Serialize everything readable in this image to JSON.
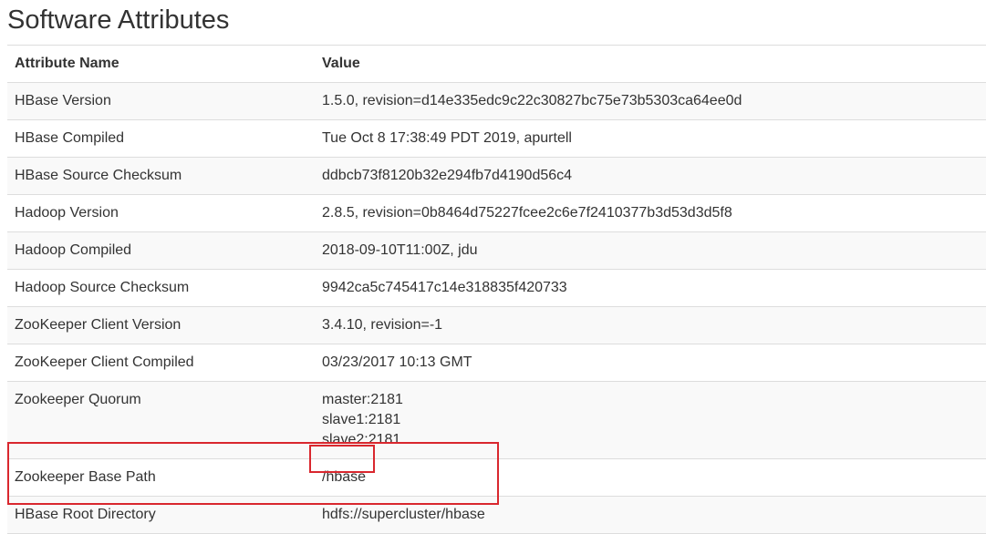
{
  "page": {
    "title": "Software Attributes"
  },
  "table": {
    "headers": {
      "name": "Attribute Name",
      "value": "Value"
    },
    "rows": [
      {
        "name": "HBase Version",
        "value": [
          "1.5.0, revision=d14e335edc9c22c30827bc75e73b5303ca64ee0d"
        ]
      },
      {
        "name": "HBase Compiled",
        "value": [
          "Tue Oct 8 17:38:49 PDT 2019, apurtell"
        ]
      },
      {
        "name": "HBase Source Checksum",
        "value": [
          "ddbcb73f8120b32e294fb7d4190d56c4"
        ]
      },
      {
        "name": "Hadoop Version",
        "value": [
          "2.8.5, revision=0b8464d75227fcee2c6e7f2410377b3d53d3d5f8"
        ]
      },
      {
        "name": "Hadoop Compiled",
        "value": [
          "2018-09-10T11:00Z, jdu"
        ]
      },
      {
        "name": "Hadoop Source Checksum",
        "value": [
          "9942ca5c745417c14e318835f420733"
        ]
      },
      {
        "name": "ZooKeeper Client Version",
        "value": [
          "3.4.10, revision=-1"
        ]
      },
      {
        "name": "ZooKeeper Client Compiled",
        "value": [
          "03/23/2017 10:13 GMT"
        ]
      },
      {
        "name": "Zookeeper Quorum",
        "value": [
          "master:2181",
          "slave1:2181",
          "slave2:2181"
        ]
      },
      {
        "name": "Zookeeper Base Path",
        "value": [
          "/hbase"
        ]
      },
      {
        "name": "HBase Root Directory",
        "value": [
          "hdfs://supercluster/hbase"
        ]
      }
    ]
  },
  "colors": {
    "highlight": "#d9272e",
    "stripe": "#f9f9f9",
    "border": "#dddddd"
  }
}
